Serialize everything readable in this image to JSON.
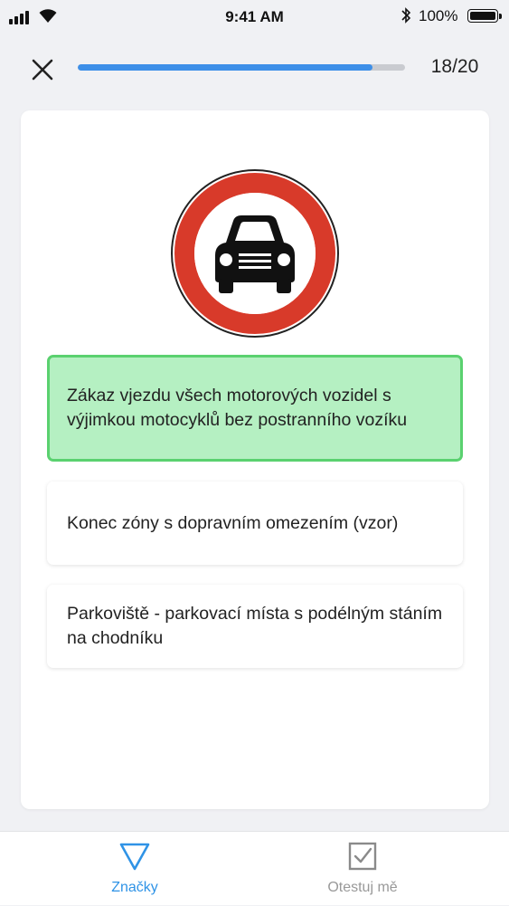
{
  "status_bar": {
    "time": "9:41 AM",
    "battery": "100%",
    "icons": [
      "signal-icon",
      "wifi-icon",
      "bluetooth-icon",
      "battery-icon"
    ]
  },
  "quiz": {
    "progress": {
      "label": "18/20",
      "current": 18,
      "total": 20,
      "fraction": 0.9
    },
    "sign": {
      "icon": "no-motor-vehicles-sign",
      "ring_color": "#d83a2a",
      "glyph_color": "#111111"
    },
    "answers": [
      {
        "text": "Zákaz vjezdu všech motorových vozidel s výjimkou motocyklů bez postranního vozíku",
        "state": "correct"
      },
      {
        "text": "Konec zóny s dopravním omezením (vzor)",
        "state": "default"
      },
      {
        "text": "Parkoviště - parkovací místa s podélným stáním na chodníku",
        "state": "default"
      }
    ]
  },
  "tab_bar": {
    "tabs": [
      {
        "label": "Značky",
        "icon": "triangle-icon",
        "active": true
      },
      {
        "label": "Otestuj mě",
        "icon": "checkbox-icon",
        "active": false
      }
    ]
  },
  "colors": {
    "accent": "#2f93e6",
    "progress": "#3d8fe8",
    "correct_bg": "#b5f0c2",
    "correct_border": "#5ad16f",
    "background": "#f0f1f4"
  }
}
